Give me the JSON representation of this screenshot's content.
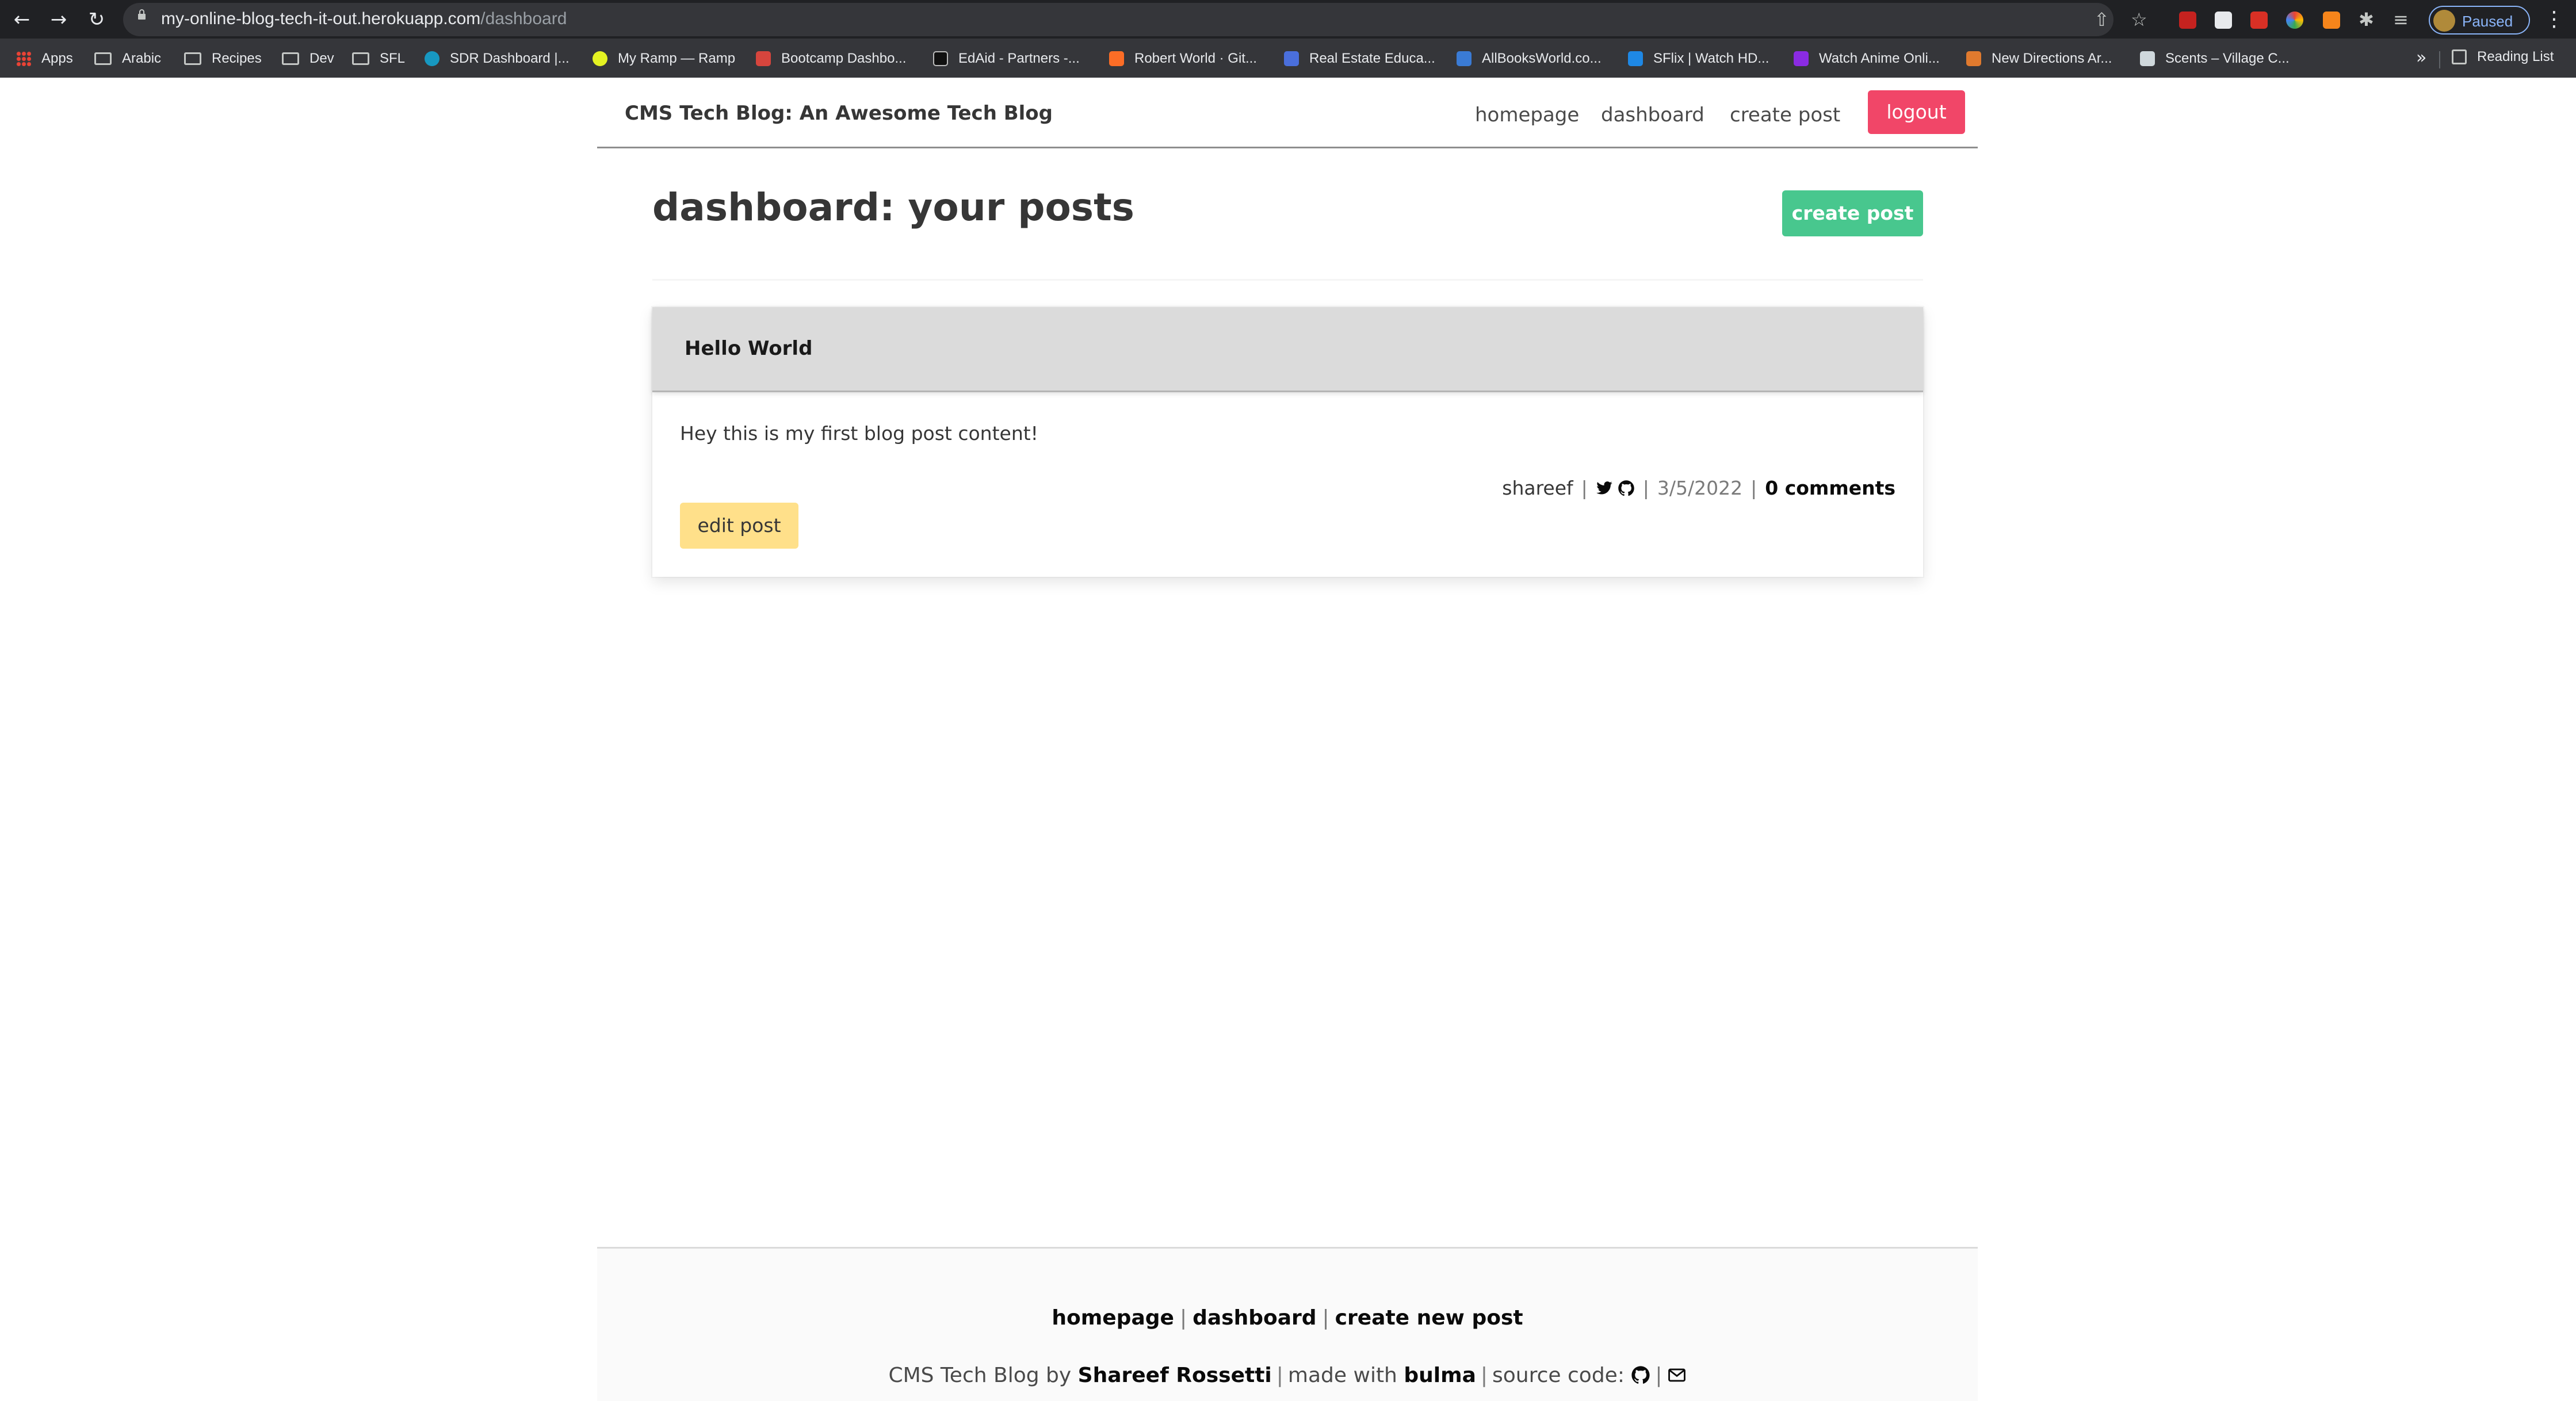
{
  "browser": {
    "url_host": "my-online-blog-tech-it-out.herokuapp.com",
    "url_path": "/dashboard",
    "profile_status": "Paused",
    "bookmarks": [
      {
        "label": "Apps",
        "icon": "apps-grid-icon"
      },
      {
        "label": "Arabic",
        "icon": "folder-icon"
      },
      {
        "label": "Recipes",
        "icon": "folder-icon"
      },
      {
        "label": "Dev",
        "icon": "folder-icon"
      },
      {
        "label": "SFL",
        "icon": "folder-icon"
      },
      {
        "label": "SDR Dashboard |...",
        "icon": "salesforce-icon"
      },
      {
        "label": "My Ramp — Ramp",
        "icon": "ramp-icon"
      },
      {
        "label": "Bootcamp Dashbo...",
        "icon": "bootcamp-icon"
      },
      {
        "label": "EdAid - Partners -...",
        "icon": "edaid-icon"
      },
      {
        "label": "Robert World · Git...",
        "icon": "gitlab-icon"
      },
      {
        "label": "Real Estate Educa...",
        "icon": "realestate-icon"
      },
      {
        "label": "AllBooksWorld.co...",
        "icon": "books-icon"
      },
      {
        "label": "SFlix | Watch HD...",
        "icon": "sflix-icon"
      },
      {
        "label": "Watch Anime Onli...",
        "icon": "anime-icon"
      },
      {
        "label": "New Directions Ar...",
        "icon": "newdirections-icon"
      },
      {
        "label": "Scents – Village C...",
        "icon": "scents-icon"
      }
    ],
    "more_bookmarks": "»",
    "reading_list": "Reading List"
  },
  "nav": {
    "brand": "CMS Tech Blog: An Awesome Tech Blog",
    "homepage": "homepage",
    "dashboard": "dashboard",
    "create_post": "create post",
    "logout": "logout"
  },
  "dashboard": {
    "title": "dashboard: your posts",
    "create_button": "create post"
  },
  "posts": [
    {
      "title": "Hello World",
      "content": "Hey this is my first blog post content!",
      "author": "shareef",
      "date": "3/5/2022",
      "comments": "0 comments",
      "edit_label": "edit post"
    }
  ],
  "footer": {
    "links": [
      "homepage",
      "dashboard",
      "create new post"
    ],
    "site_name": "CMS Tech Blog",
    "by": "by",
    "author": "Shareef Rossetti",
    "made_with": "made with",
    "framework": "bulma",
    "source_code": "source code:"
  },
  "colors": {
    "logout": "#f14668",
    "create": "#48c78e",
    "edit": "#ffe08a",
    "card_header": "#dbdbdb"
  }
}
